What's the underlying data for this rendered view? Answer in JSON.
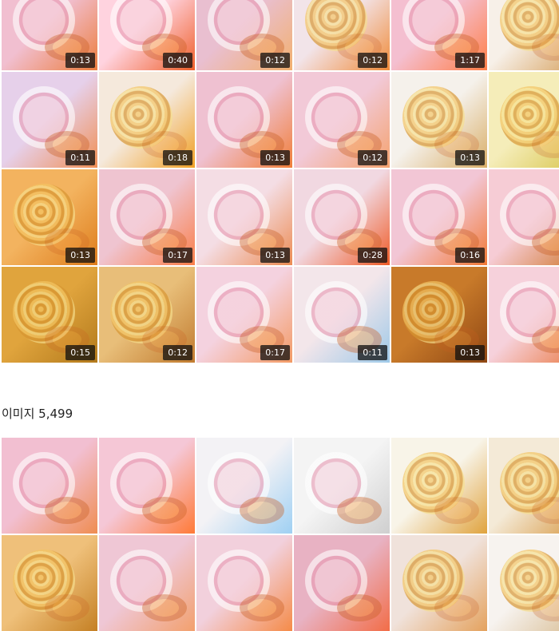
{
  "video_section": {
    "thumbnails": [
      {
        "duration": "0:13",
        "color_a": "#f1bfd0",
        "color_b": "#ec7d3d",
        "style": "cup"
      },
      {
        "duration": "0:40",
        "color_a": "#ffd3df",
        "color_b": "#ef5f2a",
        "style": "cup"
      },
      {
        "duration": "0:12",
        "color_a": "#e9bfd0",
        "color_b": "#f2b06e",
        "style": "cup"
      },
      {
        "duration": "0:12",
        "color_a": "#f2e4e9",
        "color_b": "#f08b39",
        "style": "noodle"
      },
      {
        "duration": "1:17",
        "color_a": "#f4bfd0",
        "color_b": "#ff7e47",
        "style": "cup"
      },
      {
        "duration": "",
        "color_a": "#f7f0e8",
        "color_b": "#d6a05c",
        "style": "noodle"
      },
      {
        "duration": "0:11",
        "color_a": "#e6d0ea",
        "color_b": "#f08f54",
        "style": "cup"
      },
      {
        "duration": "0:18",
        "color_a": "#f5e9dc",
        "color_b": "#f0a025",
        "style": "noodle"
      },
      {
        "duration": "0:13",
        "color_a": "#efc1d1",
        "color_b": "#f07e39",
        "style": "cup"
      },
      {
        "duration": "0:12",
        "color_a": "#f2c9d7",
        "color_b": "#f4a26e",
        "style": "cup"
      },
      {
        "duration": "0:13",
        "color_a": "#f5f1eb",
        "color_b": "#d9ae67",
        "style": "noodle"
      },
      {
        "duration": "",
        "color_a": "#f5edb9",
        "color_b": "#d8c54d",
        "style": "noodle"
      },
      {
        "duration": "0:13",
        "color_a": "#f3b35f",
        "color_b": "#de7d1c",
        "style": "noodle"
      },
      {
        "duration": "0:17",
        "color_a": "#efc4d0",
        "color_b": "#fa7e49",
        "style": "cup"
      },
      {
        "duration": "0:13",
        "color_a": "#f4dde4",
        "color_b": "#ec8b52",
        "style": "cup"
      },
      {
        "duration": "0:28",
        "color_a": "#f1d8e1",
        "color_b": "#ef5b27",
        "style": "cup"
      },
      {
        "duration": "0:16",
        "color_a": "#f2c6d5",
        "color_b": "#f17935",
        "style": "cup"
      },
      {
        "duration": "",
        "color_a": "#f6ccd5",
        "color_b": "#d0782e",
        "style": "cup"
      },
      {
        "duration": "0:15",
        "color_a": "#e0a43d",
        "color_b": "#b37a1c",
        "style": "noodle"
      },
      {
        "duration": "0:12",
        "color_a": "#e8be79",
        "color_b": "#c17b2f",
        "style": "noodle"
      },
      {
        "duration": "0:17",
        "color_a": "#f4d2df",
        "color_b": "#f39a64",
        "style": "cup"
      },
      {
        "duration": "0:11",
        "color_a": "#f3e6ea",
        "color_b": "#9ec9e8",
        "style": "cup"
      },
      {
        "duration": "0:13",
        "color_a": "#c87a2a",
        "color_b": "#8f4713",
        "style": "noodle"
      },
      {
        "duration": "",
        "color_a": "#f6d1db",
        "color_b": "#ea7b45",
        "style": "cup"
      }
    ]
  },
  "image_section": {
    "title": "이미지 5,499",
    "thumbnails": [
      {
        "color_a": "#f2bfd1",
        "color_b": "#ef8d52",
        "style": "cup"
      },
      {
        "color_a": "#f5c7d6",
        "color_b": "#ff7a37",
        "style": "cup"
      },
      {
        "color_a": "#f3f2f5",
        "color_b": "#9fd0f3",
        "style": "cup"
      },
      {
        "color_a": "#f4f4f4",
        "color_b": "#cfcfcf",
        "style": "cup"
      },
      {
        "color_a": "#f8f4e8",
        "color_b": "#e0a33e",
        "style": "noodle"
      },
      {
        "color_a": "#f4ead7",
        "color_b": "#d89a46",
        "style": "noodle"
      },
      {
        "color_a": "#efc07a",
        "color_b": "#c58024",
        "style": "noodle"
      },
      {
        "color_a": "#efc7d5",
        "color_b": "#f2a06d",
        "style": "cup"
      },
      {
        "color_a": "#f2d0dc",
        "color_b": "#f58b48",
        "style": "cup"
      },
      {
        "color_a": "#e8b2c3",
        "color_b": "#f26d47",
        "style": "cup"
      },
      {
        "color_a": "#f0e2db",
        "color_b": "#e4a25e",
        "style": "noodle"
      },
      {
        "color_a": "#f7f3ef",
        "color_b": "#d8bc92",
        "style": "noodle"
      }
    ]
  }
}
